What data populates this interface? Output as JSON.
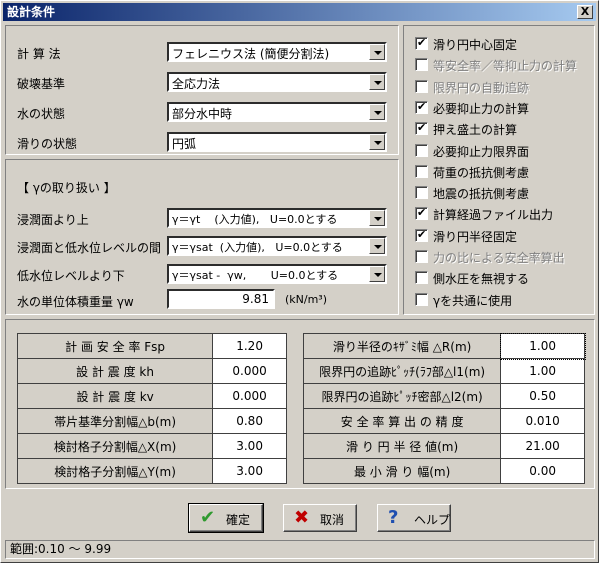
{
  "window": {
    "title": "設計条件",
    "close_label": "X"
  },
  "left_fields": [
    {
      "label": "計 算 法",
      "value": "フェレニウス法 (簡便分割法)"
    },
    {
      "label": "破壊基準",
      "value": "全応力法"
    },
    {
      "label": "水の状態",
      "value": "部分水中時"
    },
    {
      "label": "滑りの状態",
      "value": "円弧"
    }
  ],
  "gamma": {
    "header": "【 γの取り扱い 】",
    "rows": [
      {
        "label": "浸潤面より上",
        "value": "γ＝γt    (入力値),   U=0.0とする"
      },
      {
        "label": "浸潤面と低水位レベルの間",
        "value": "γ＝γsat  (入力値),   U=0.0とする"
      },
      {
        "label": "低水位レベルより下",
        "value": "γ＝γsat -  γw,       U=0.0とする"
      }
    ],
    "unit_weight_label": "水の単位体積重量 γw",
    "unit_weight_value": "9.81",
    "unit_weight_unit": "(kN/m³)"
  },
  "checkboxes": [
    {
      "label": "滑り円中心固定",
      "checked": true,
      "disabled": false
    },
    {
      "label": "等安全率／等抑止力の計算",
      "checked": false,
      "disabled": true
    },
    {
      "label": "限界円の自動追跡",
      "checked": false,
      "disabled": true
    },
    {
      "label": "必要抑止力の計算",
      "checked": true,
      "disabled": false
    },
    {
      "label": "押え盛土の計算",
      "checked": true,
      "disabled": false
    },
    {
      "label": "必要抑止力限界面",
      "checked": false,
      "disabled": false
    },
    {
      "label": "荷重の抵抗側考慮",
      "checked": false,
      "disabled": false
    },
    {
      "label": "地震の抵抗側考慮",
      "checked": false,
      "disabled": false
    },
    {
      "label": "計算経過ファイル出力",
      "checked": true,
      "disabled": false
    },
    {
      "label": "滑り円半径固定",
      "checked": true,
      "disabled": false
    },
    {
      "label": "力の比による安全率算出",
      "checked": false,
      "disabled": true
    },
    {
      "label": "側水圧を無視する",
      "checked": false,
      "disabled": false
    },
    {
      "label": "γを共通に使用",
      "checked": false,
      "disabled": false
    }
  ],
  "table": {
    "left": [
      {
        "label": "計 画 安 全 率 Fsp",
        "value": "1.20"
      },
      {
        "label": "設  計  震  度  kh",
        "value": "0.000"
      },
      {
        "label": "設  計  震  度  kv",
        "value": "0.000"
      },
      {
        "label": "帯片基準分割幅△b(m)",
        "value": "0.80"
      },
      {
        "label": "検討格子分割幅△X(m)",
        "value": "3.00"
      },
      {
        "label": "検討格子分割幅△Y(m)",
        "value": "3.00"
      }
    ],
    "right": [
      {
        "label": "滑り半径のｷｻﾞﾐ幅   △R(m)",
        "value": "1.00"
      },
      {
        "label": "限界円の追跡ﾋﾟｯﾁ(ﾗﾌ部△l1(m)",
        "value": "1.00"
      },
      {
        "label": "限界円の追跡ﾋﾟｯﾁ密部△l2(m)",
        "value": "0.50"
      },
      {
        "label": "安 全 率 算 出 の 精 度",
        "value": "0.010"
      },
      {
        "label": "滑 り 円 半 径  値(m)",
        "value": "21.00"
      },
      {
        "label": "最 小 滑 り  幅(m)",
        "value": "0.00"
      }
    ]
  },
  "buttons": {
    "ok": "確定",
    "cancel": "取消",
    "help": "ヘルプ"
  },
  "icons": {
    "ok": "check-icon",
    "cancel": "x-icon",
    "help": "question-icon"
  },
  "colors": {
    "ok_icon": "#2f9a2f",
    "cancel_icon": "#c00000",
    "help_icon": "#1f4fb0"
  },
  "status": "範囲:0.10 〜 9.99"
}
